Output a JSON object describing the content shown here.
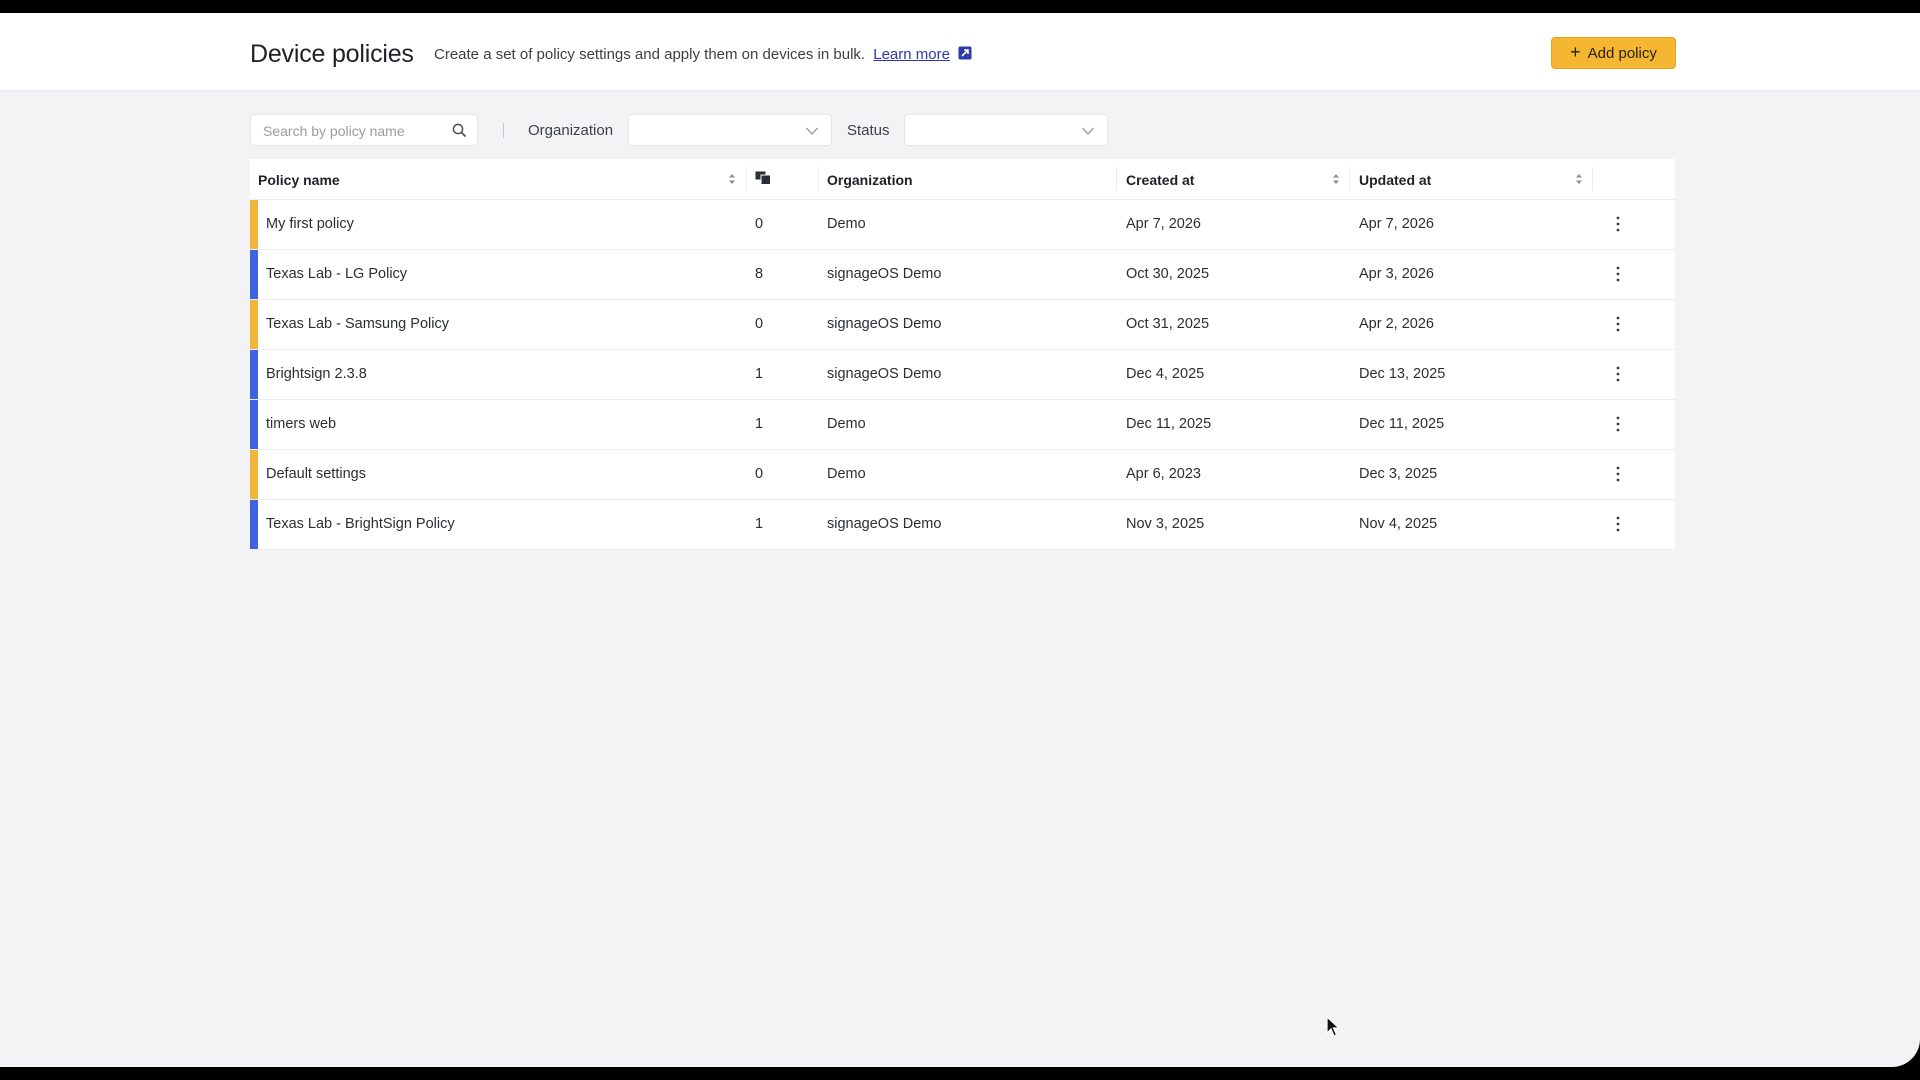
{
  "header": {
    "title": "Device policies",
    "subtitle": "Create a set of policy settings and apply them on devices in bulk.",
    "learn_more": "Learn more",
    "add_button": "Add policy"
  },
  "filters": {
    "search_placeholder": "Search by policy name",
    "organization_label": "Organization",
    "organization_value": "",
    "status_label": "Status",
    "status_value": ""
  },
  "table": {
    "columns": {
      "name": "Policy name",
      "devices_icon": "devices-icon",
      "organization": "Organization",
      "created": "Created at",
      "updated": "Updated at"
    },
    "rows": [
      {
        "name": "My first policy",
        "count": "0",
        "org": "Demo",
        "created": "Apr 7, 2026",
        "updated": "Apr 7, 2026",
        "color": "#f0b63a"
      },
      {
        "name": "Texas Lab - LG Policy",
        "count": "8",
        "org": "signageOS Demo",
        "created": "Oct 30, 2025",
        "updated": "Apr 3, 2026",
        "color": "#3d63e0"
      },
      {
        "name": "Texas Lab - Samsung Policy",
        "count": "0",
        "org": "signageOS Demo",
        "created": "Oct 31, 2025",
        "updated": "Apr 2, 2026",
        "color": "#f0b63a"
      },
      {
        "name": "Brightsign 2.3.8",
        "count": "1",
        "org": "signageOS Demo",
        "created": "Dec 4, 2025",
        "updated": "Dec 13, 2025",
        "color": "#3d63e0"
      },
      {
        "name": "timers web",
        "count": "1",
        "org": "Demo",
        "created": "Dec 11, 2025",
        "updated": "Dec 11, 2025",
        "color": "#3d63e0"
      },
      {
        "name": "Default settings",
        "count": "0",
        "org": "Demo",
        "created": "Apr 6, 2023",
        "updated": "Dec 3, 2025",
        "color": "#f0b63a"
      },
      {
        "name": "Texas Lab - BrightSign Policy",
        "count": "1",
        "org": "signageOS Demo",
        "created": "Nov 3, 2025",
        "updated": "Nov 4, 2025",
        "color": "#3d63e0"
      }
    ]
  },
  "colors": {
    "accent": "#f5b731",
    "link": "#2d3aa8",
    "active_bar": "#3d63e0",
    "inactive_bar": "#f0b63a"
  }
}
